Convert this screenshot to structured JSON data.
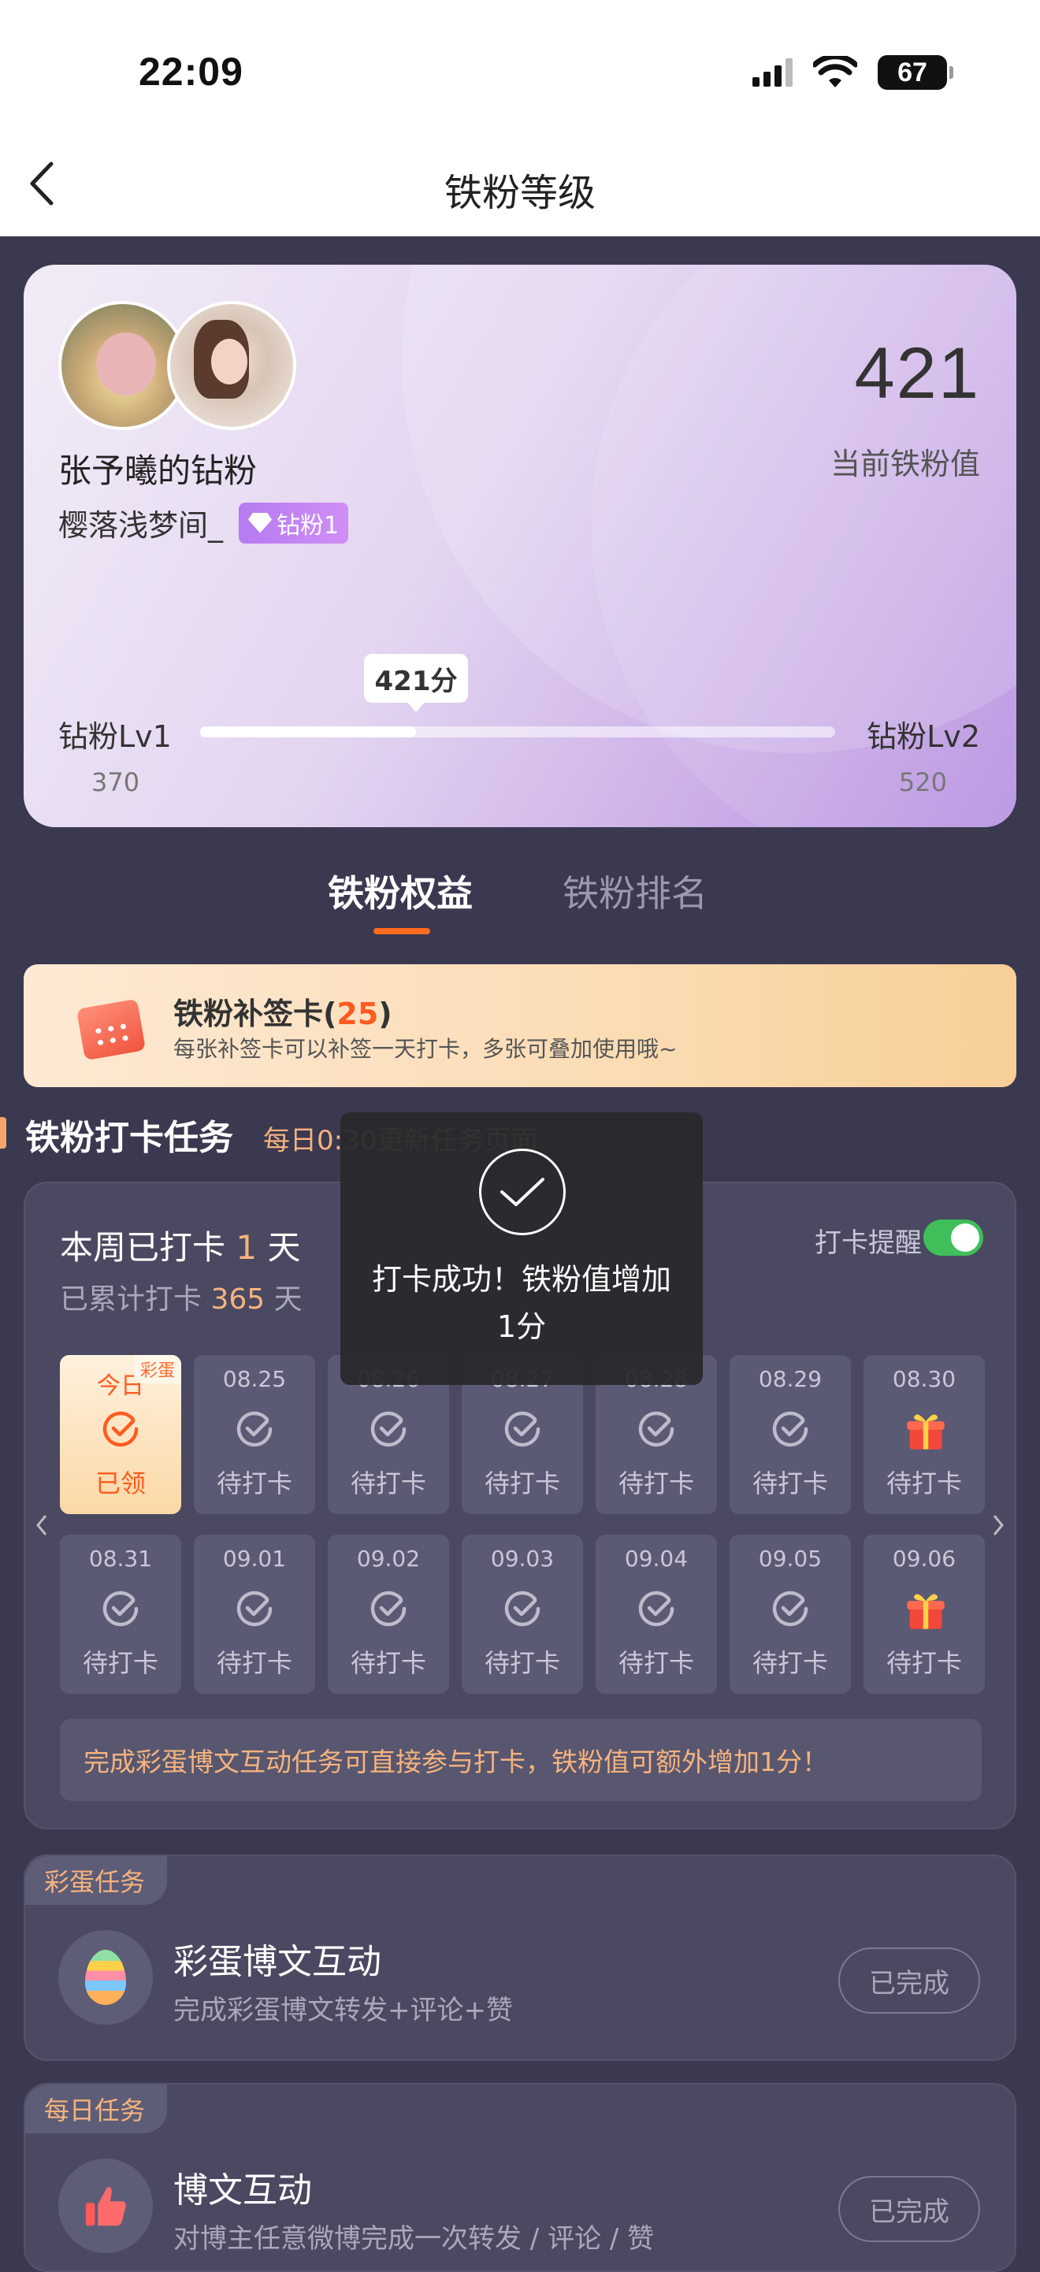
{
  "status_bar": {
    "time": "22:09",
    "battery": "67"
  },
  "nav": {
    "title": "铁粉等级"
  },
  "hero": {
    "fan_name": "张予曦的钻粉",
    "username": "樱落浅梦间_",
    "badge": "钻粉1",
    "score": "421",
    "score_label": "当前铁粉值",
    "level_left": "钻粉Lv1",
    "level_right": "钻粉Lv2",
    "level_left_value": "370",
    "level_right_value": "520",
    "progress_label": "421分",
    "progress_fraction": 0.34
  },
  "tabs": [
    {
      "label": "铁粉权益",
      "active": true
    },
    {
      "label": "铁粉排名",
      "active": false
    }
  ],
  "makeup_card": {
    "title": "铁粉补签卡",
    "count": "25",
    "description": "每张补签卡可以补签一天打卡，多张可叠加使用哦~"
  },
  "checkin_section": {
    "title": "铁粉打卡任务",
    "subtitle": "每日0:30更新任务页面"
  },
  "checkin": {
    "week_prefix": "本周已打卡",
    "week_days": "1",
    "week_suffix": "天",
    "total_prefix": "已累计打卡",
    "total_days": "365",
    "total_suffix": "天",
    "remind_label": "打卡提醒",
    "remind_on": true,
    "tip": "完成彩蛋博文互动任务可直接参与打卡，铁粉值可额外增加1分！",
    "days": [
      {
        "date": "今日",
        "status": "已领",
        "tag": "彩蛋",
        "icon": "check-circle-icon",
        "today": true
      },
      {
        "date": "08.25",
        "status": "待打卡",
        "icon": "check-circle-icon"
      },
      {
        "date": "08.26",
        "status": "待打卡",
        "icon": "check-circle-icon"
      },
      {
        "date": "08.27",
        "status": "待打卡",
        "icon": "check-circle-icon"
      },
      {
        "date": "08.28",
        "status": "待打卡",
        "icon": "check-circle-icon"
      },
      {
        "date": "08.29",
        "status": "待打卡",
        "icon": "check-circle-icon"
      },
      {
        "date": "08.30",
        "status": "待打卡",
        "icon": "gift-icon"
      },
      {
        "date": "08.31",
        "status": "待打卡",
        "icon": "check-circle-icon"
      },
      {
        "date": "09.01",
        "status": "待打卡",
        "icon": "check-circle-icon"
      },
      {
        "date": "09.02",
        "status": "待打卡",
        "icon": "check-circle-icon"
      },
      {
        "date": "09.03",
        "status": "待打卡",
        "icon": "check-circle-icon"
      },
      {
        "date": "09.04",
        "status": "待打卡",
        "icon": "check-circle-icon"
      },
      {
        "date": "09.05",
        "status": "待打卡",
        "icon": "check-circle-icon"
      },
      {
        "date": "09.06",
        "status": "待打卡",
        "icon": "gift-icon"
      }
    ]
  },
  "tasks": [
    {
      "tag": "彩蛋任务",
      "title": "彩蛋博文互动",
      "description": "完成彩蛋博文转发+评论+赞",
      "button": "已完成",
      "icon": "easter-egg-icon"
    },
    {
      "tag": "每日任务",
      "title": "博文互动",
      "description": "对博主任意微博完成一次转发 / 评论 / 赞",
      "button": "已完成",
      "icon": "thumbs-up-icon"
    }
  ],
  "toast": {
    "message": "打卡成功！铁粉值增加1分"
  },
  "colors": {
    "accent": "#ff6a1c",
    "highlight": "#f6b37e",
    "background": "#3a3950",
    "toggle_on": "#3fbe5a"
  }
}
